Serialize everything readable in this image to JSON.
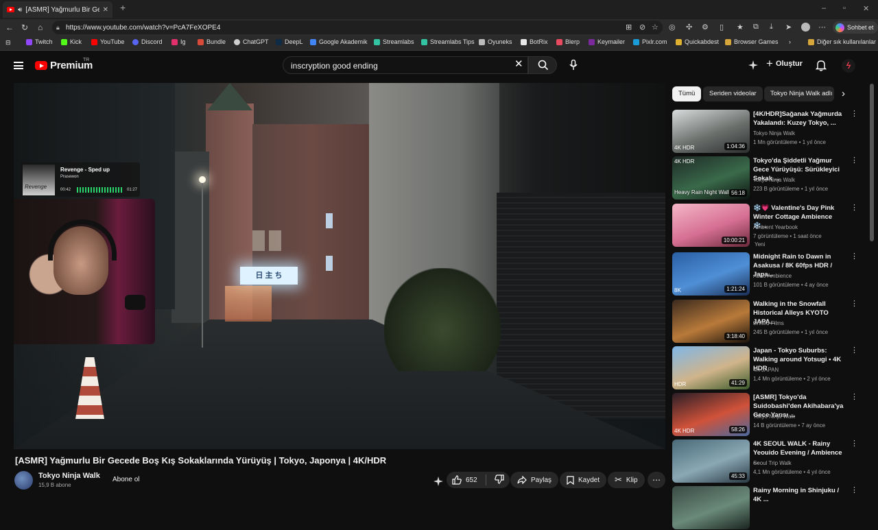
{
  "browser": {
    "tab_title": "[ASMR] Yağmurlu Bir Gecede",
    "url": "https://www.youtube.com/watch?v=PcA7FeXOPE4",
    "copilot_label": "Sohbet et",
    "bookmarks": [
      "Twitch",
      "Kick",
      "YouTube",
      "Discord",
      "Ig",
      "Bundle",
      "ChatGPT",
      "DeepL",
      "Google Akademik",
      "Streamlabs",
      "Streamlabs Tips",
      "Oyuneks",
      "BotRix",
      "Blerp",
      "Keymailer",
      "Pixlr.com",
      "Quickabdest",
      "Browser Games"
    ],
    "other_favorites": "Diğer sık kullanılanlar"
  },
  "header": {
    "logo_word": "Premium",
    "region": "TR",
    "search_value": "inscryption good ending",
    "create_label": "Oluştur"
  },
  "overlay": {
    "song": "Revenge - Sped up",
    "artist": "Prasewon",
    "time_elapsed": "00:42",
    "time_total": "01:27",
    "art_text": "Revenge",
    "sign_text": "日 主 ち"
  },
  "video": {
    "title": "[ASMR] Yağmurlu Bir Gecede Boş Kış Sokaklarında Yürüyüş | Tokyo, Japonya | 4K/HDR",
    "channel": "Tokyo Ninja Walk",
    "subscribers": "15,9 B abone",
    "subscribe_label": "Abone ol",
    "likes": "652",
    "share_label": "Paylaş",
    "save_label": "Kaydet",
    "clip_label": "Klip"
  },
  "chips": [
    "Tümü",
    "Seriden videolar",
    "Tokyo Ninja Walk adlı"
  ],
  "recommendations": [
    {
      "title": "[4K/HDR]Sağanak Yağmurda Yakalandı: Kuzey Tokyo, ...",
      "channel": "Tokyo Ninja Walk",
      "meta": "1 Mn görüntüleme • 1 yıl önce",
      "duration": "1:04:36",
      "badge": "4K HDR",
      "thumb_colors": [
        "#d8dcdc",
        "#6b6f6c",
        "#2c2f2f"
      ]
    },
    {
      "title": "Tokyo'da Şiddetli Yağmur Gece Yürüyüşü: Sürükleyici Sokak ...",
      "channel": "Tokyo Ninja Walk",
      "meta": "223 B görüntüleme • 1 yıl önce",
      "duration": "56:18",
      "badge": "4K HDR",
      "thumb_text": "Heavy Rain Night Wall",
      "thumb_colors": [
        "#1e2a26",
        "#3a6a4a",
        "#0c1210"
      ]
    },
    {
      "title": "❄️💗 Valentine's Day Pink Winter Cottage Ambience ❄️...",
      "channel": "Ambient Yearbook",
      "meta": "7 görüntüleme • 1 saat önce",
      "duration": "10:00:21",
      "new_label": "Yeni",
      "thumb_colors": [
        "#f4b7c8",
        "#d66f93",
        "#6b2a3c"
      ]
    },
    {
      "title": "Midnight Rain to Dawn in Asakusa / 8K 60fps HDR / Japa...",
      "channel": "Abao Ambience",
      "meta": "101 B görüntüleme • 4 ay önce",
      "duration": "1:21:24",
      "badge": "8K",
      "thumb_colors": [
        "#2a5fa3",
        "#4f8fd6",
        "#1b2f55"
      ]
    },
    {
      "title": "Walking in the Snowfall Historical Alleys KYOTO JAPA...",
      "channel": "Drifted Films",
      "meta": "245 B görüntüleme • 1 yıl önce",
      "duration": "3:18:40",
      "thumb_colors": [
        "#3a2a1e",
        "#b97a3a",
        "#1a120c"
      ]
    },
    {
      "title": "Japan - Tokyo Suburbs: Walking around Yotsugi • 4K HDR",
      "channel": "4K JAPAN",
      "meta": "1,4 Mn görüntüleme • 2 yıl önce",
      "duration": "41:29",
      "badge": "HDR",
      "thumb_colors": [
        "#7fb6e8",
        "#d0b48a",
        "#3a5a2a"
      ]
    },
    {
      "title": "[ASMR] Tokyo'da Suidobashi'den Akihabara'ya Gece Yarısı ...",
      "channel": "Tokyo Ninja Walk",
      "meta": "14 B görüntüleme • 7 ay önce",
      "duration": "58:26",
      "badge": "4K HDR",
      "thumb_colors": [
        "#2a1e26",
        "#d0523a",
        "#4a6aa0"
      ]
    },
    {
      "title": "4K SEOUL WALK - Rainy Yeouido Evening / Ambience ...",
      "channel": "Seoul Trip Walk",
      "meta": "4,1 Mn görüntüleme • 4 yıl önce",
      "duration": "45:33",
      "thumb_colors": [
        "#4a6a78",
        "#8aa8b4",
        "#2a3a44"
      ]
    },
    {
      "title": "Rainy Morning in Shinjuku / 4K ...",
      "channel": "",
      "meta": "",
      "duration": "",
      "thumb_colors": [
        "#3a4a44",
        "#6a8a7a",
        "#1a2420"
      ]
    }
  ]
}
